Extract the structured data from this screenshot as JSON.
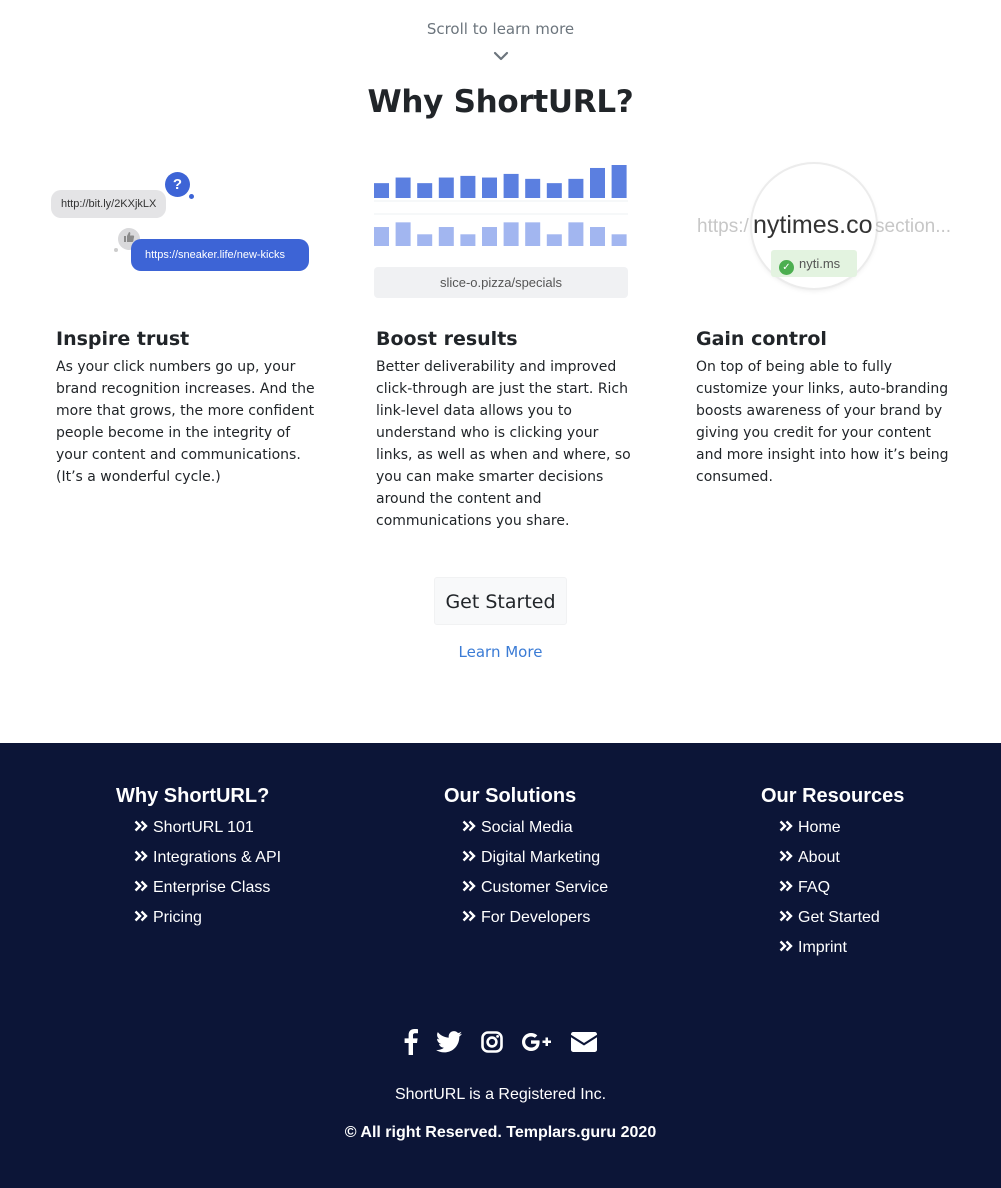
{
  "scroll_hint": "Scroll to learn more",
  "section_title": "Why ShortURL?",
  "illustrations": {
    "chat": {
      "short_link": "http://bit.ly/2KXjkLX",
      "question_mark": "?",
      "long_link": "https://sneaker.life/new-kicks"
    },
    "chart": {
      "top_bar_heights": [
        0.45,
        0.62,
        0.45,
        0.62,
        0.67,
        0.62,
        0.73,
        0.58,
        0.45,
        0.58,
        0.91,
        1.0
      ],
      "bottom_bar_heights": [
        0.73,
        0.91,
        0.45,
        0.73,
        0.45,
        0.73,
        0.91,
        0.91,
        0.45,
        0.91,
        0.73,
        0.45
      ],
      "top_bar_color": "#5b7fe0",
      "bottom_bar_color": "#a2b6f0",
      "url": "slice-o.pizza/specials"
    },
    "branding": {
      "url_left": "https:/",
      "url_main": "nytimes.co",
      "url_right": "section...",
      "short_domain": "nyti.ms"
    }
  },
  "features": [
    {
      "title": "Inspire trust",
      "text": "As your click numbers go up, your brand recognition increases. And the more that grows, the more confident people become in the integrity of your content and communications. (It’s a wonderful cycle.)"
    },
    {
      "title": "Boost results",
      "text": "Better deliverability and improved click-through are just the start. Rich link-level data allows you to understand who is clicking your links, as well as when and where, so you can make smarter decisions around the content and communications you share."
    },
    {
      "title": "Gain control",
      "text": "On top of being able to fully customize your links, auto-branding boosts awareness of your brand by giving you credit for your content and more insight into how it’s being consumed."
    }
  ],
  "cta": {
    "get_started": "Get Started",
    "learn_more": "Learn More"
  },
  "footer": {
    "columns": [
      {
        "title": "Why ShortURL?",
        "links": [
          "ShortURL 101",
          "Integrations & API",
          "Enterprise Class",
          "Pricing"
        ]
      },
      {
        "title": "Our Solutions",
        "links": [
          "Social Media",
          "Digital Marketing",
          "Customer Service",
          "For Developers"
        ]
      },
      {
        "title": "Our Resources",
        "links": [
          "Home",
          "About",
          "FAQ",
          "Get Started",
          "Imprint"
        ]
      }
    ],
    "social_icons": [
      "facebook-icon",
      "twitter-icon",
      "instagram-icon",
      "google-plus-icon",
      "envelope-icon"
    ],
    "registered": "ShortURL is a Registered Inc.",
    "copyright": "© All right Reserved.  Templars.guru 2020"
  },
  "colors": {
    "footer_bg": "#0c1537",
    "link": "#3a7bd5",
    "accent_blue": "#3d64d6"
  }
}
